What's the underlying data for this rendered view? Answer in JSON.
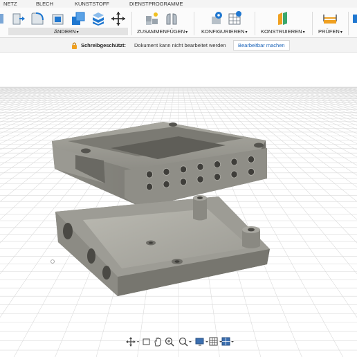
{
  "ribbon": {
    "tabs": [
      "NETZ",
      "BLECH",
      "KUNSTSTOFF",
      "DIENSTPROGRAMME"
    ],
    "groups": {
      "modify": "ÄNDERN",
      "assemble": "ZUSAMMENFÜGEN",
      "configure": "KONFIGURIEREN",
      "construct": "KONSTRUIEREN",
      "inspect": "PRÜFEN"
    },
    "caret": "▾"
  },
  "lockbar": {
    "title": "Schreibgeschützt:",
    "message": "Dokument kann nicht bearbeitet werden",
    "button": "Bearbeitbar machen"
  },
  "icons": {
    "modify": [
      "press-pull-icon",
      "fillet-icon",
      "shell-icon",
      "combine-icon",
      "split-body-icon",
      "move-icon"
    ],
    "assemble": [
      "new-component-icon",
      "joint-icon"
    ],
    "configure": [
      "configure-icon",
      "table-icon"
    ],
    "construct": [
      "offset-plane-icon"
    ],
    "inspect": [
      "measure-icon"
    ],
    "navigation": [
      "orbit-icon",
      "pan-icon",
      "zoom-window-icon",
      "zoom-icon",
      "display-settings-icon",
      "grid-icon",
      "viewports-icon"
    ]
  },
  "colors": {
    "accent_blue": "#1f77d0",
    "model_grey": "#8f8e87",
    "lock_orange": "#f0a020",
    "link_blue": "#1a63b8"
  }
}
